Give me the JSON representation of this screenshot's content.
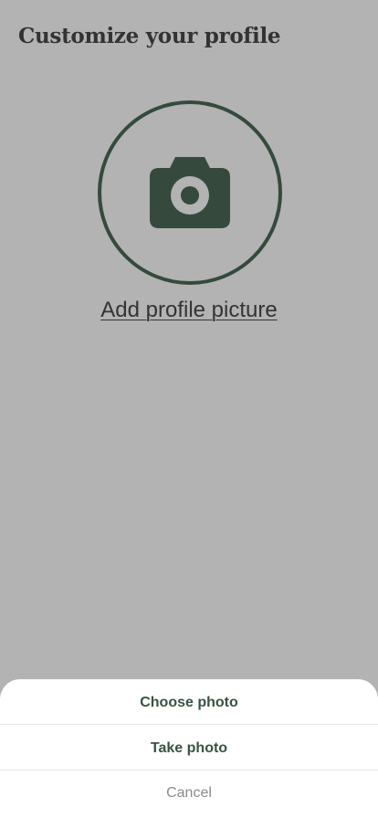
{
  "header": {
    "title": "Customize your profile"
  },
  "avatar": {
    "icon": "camera-icon",
    "add_label": "Add profile picture"
  },
  "action_sheet": {
    "options": [
      {
        "label": "Choose photo"
      },
      {
        "label": "Take photo"
      }
    ],
    "cancel_label": "Cancel"
  },
  "colors": {
    "overlay_background": "#b3b3b3",
    "accent": "#354a3d",
    "option_text": "#3a5243",
    "cancel_text": "#8a8a8a",
    "sheet_background": "#ffffff"
  }
}
